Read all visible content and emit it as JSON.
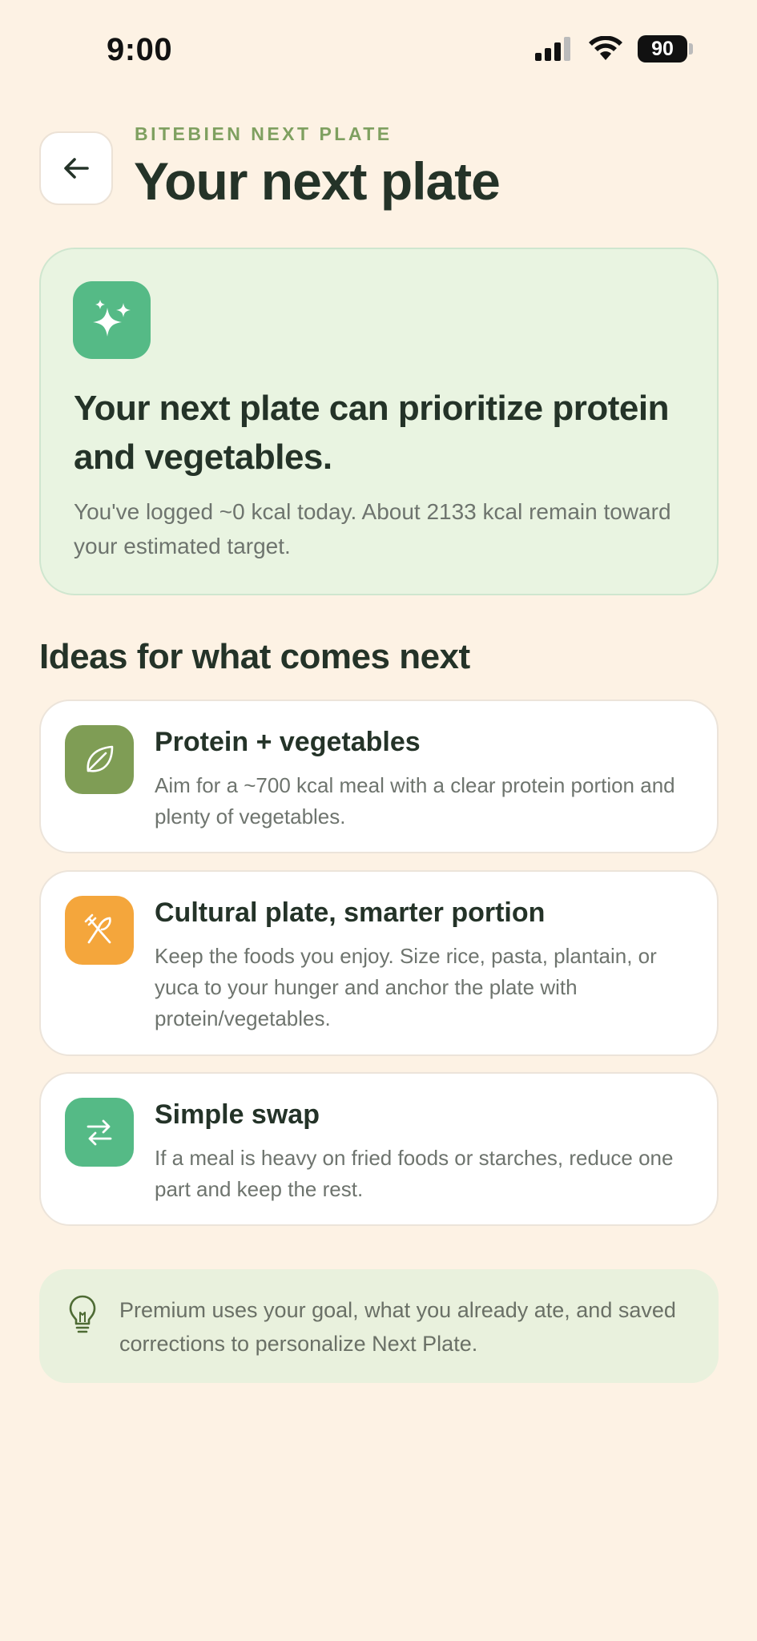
{
  "status_bar": {
    "time": "9:00",
    "battery": "90",
    "icons": [
      "signal-icon",
      "wifi-icon",
      "battery-icon"
    ]
  },
  "header": {
    "back_icon": "arrow-left-icon",
    "eyebrow": "BITEBIEN NEXT PLATE",
    "title": "Your next plate"
  },
  "hero": {
    "icon": "sparkles-icon",
    "headline": "Your next plate can prioritize protein and vegetables.",
    "body": "You've logged ~0 kcal today. About 2133 kcal remain toward your estimated target."
  },
  "section": {
    "title": "Ideas for what comes next"
  },
  "ideas": [
    {
      "icon": "leaf-icon",
      "color": "#7F9D55",
      "title": "Protein + vegetables",
      "body": "Aim for a ~700 kcal meal with a clear protein portion and plenty of vegetables."
    },
    {
      "icon": "utensils-crossed-icon",
      "color": "#F4A63C",
      "title": "Cultural plate, smarter portion",
      "body": "Keep the foods you enjoy. Size rice, pasta, plantain, or yuca to your hunger and anchor the plate with protein/vegetables."
    },
    {
      "icon": "swap-arrows-icon",
      "color": "#55BA86",
      "title": "Simple swap",
      "body": "If a meal is heavy on fried foods or starches, reduce one part and keep the rest."
    }
  ],
  "premium_note": {
    "icon": "lightbulb-icon",
    "text": "Premium uses your goal, what you already ate, and saved corrections to personalize Next Plate."
  },
  "colors": {
    "background": "#FDF2E4",
    "accent_green": "#55BA86",
    "eyebrow_green": "#7FA060",
    "hero_card": "#E9F4E1",
    "text_dark": "#243328",
    "text_muted": "#6E746E"
  }
}
